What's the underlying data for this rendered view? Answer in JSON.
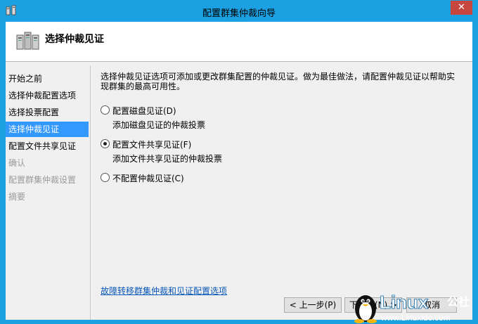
{
  "window": {
    "title": "配置群集仲裁向导",
    "close_glyph": "✕"
  },
  "header": {
    "title": "选择仲裁见证"
  },
  "nav": {
    "items": [
      {
        "label": "开始之前",
        "state": "normal"
      },
      {
        "label": "选择仲裁配置选项",
        "state": "normal"
      },
      {
        "label": "选择投票配置",
        "state": "normal"
      },
      {
        "label": "选择仲裁见证",
        "state": "active"
      },
      {
        "label": "配置文件共享见证",
        "state": "normal"
      },
      {
        "label": "确认",
        "state": "disabled"
      },
      {
        "label": "配置群集仲裁设置",
        "state": "disabled"
      },
      {
        "label": "摘要",
        "state": "disabled"
      }
    ]
  },
  "main": {
    "description": "选择仲裁见证选项可添加或更改群集配置的仲裁见证。做为最佳做法，请配置仲裁见证以帮助实现群集的最高可用性。",
    "options": [
      {
        "label": "配置磁盘见证(D)",
        "sub": "添加磁盘见证的仲裁投票",
        "checked": false
      },
      {
        "label": "配置文件共享见证(F)",
        "sub": "添加文件共享见证的仲裁投票",
        "checked": true
      },
      {
        "label": "不配置仲裁见证(C)",
        "sub": "",
        "checked": false
      }
    ],
    "link": "故障转移群集仲裁和见证配置选项"
  },
  "buttons": {
    "prev": "< 上一步(P)",
    "next": "下一步(N) >",
    "cancel": "取消"
  },
  "watermark": {
    "brand": "Linux",
    "brand_suffix": "公社",
    "url": "www.Linuxidc.com"
  },
  "colors": {
    "title_bar": "#1BA1E2",
    "nav_active": "#3399FF",
    "link": "#0A58B8",
    "close": "#C7463E"
  }
}
